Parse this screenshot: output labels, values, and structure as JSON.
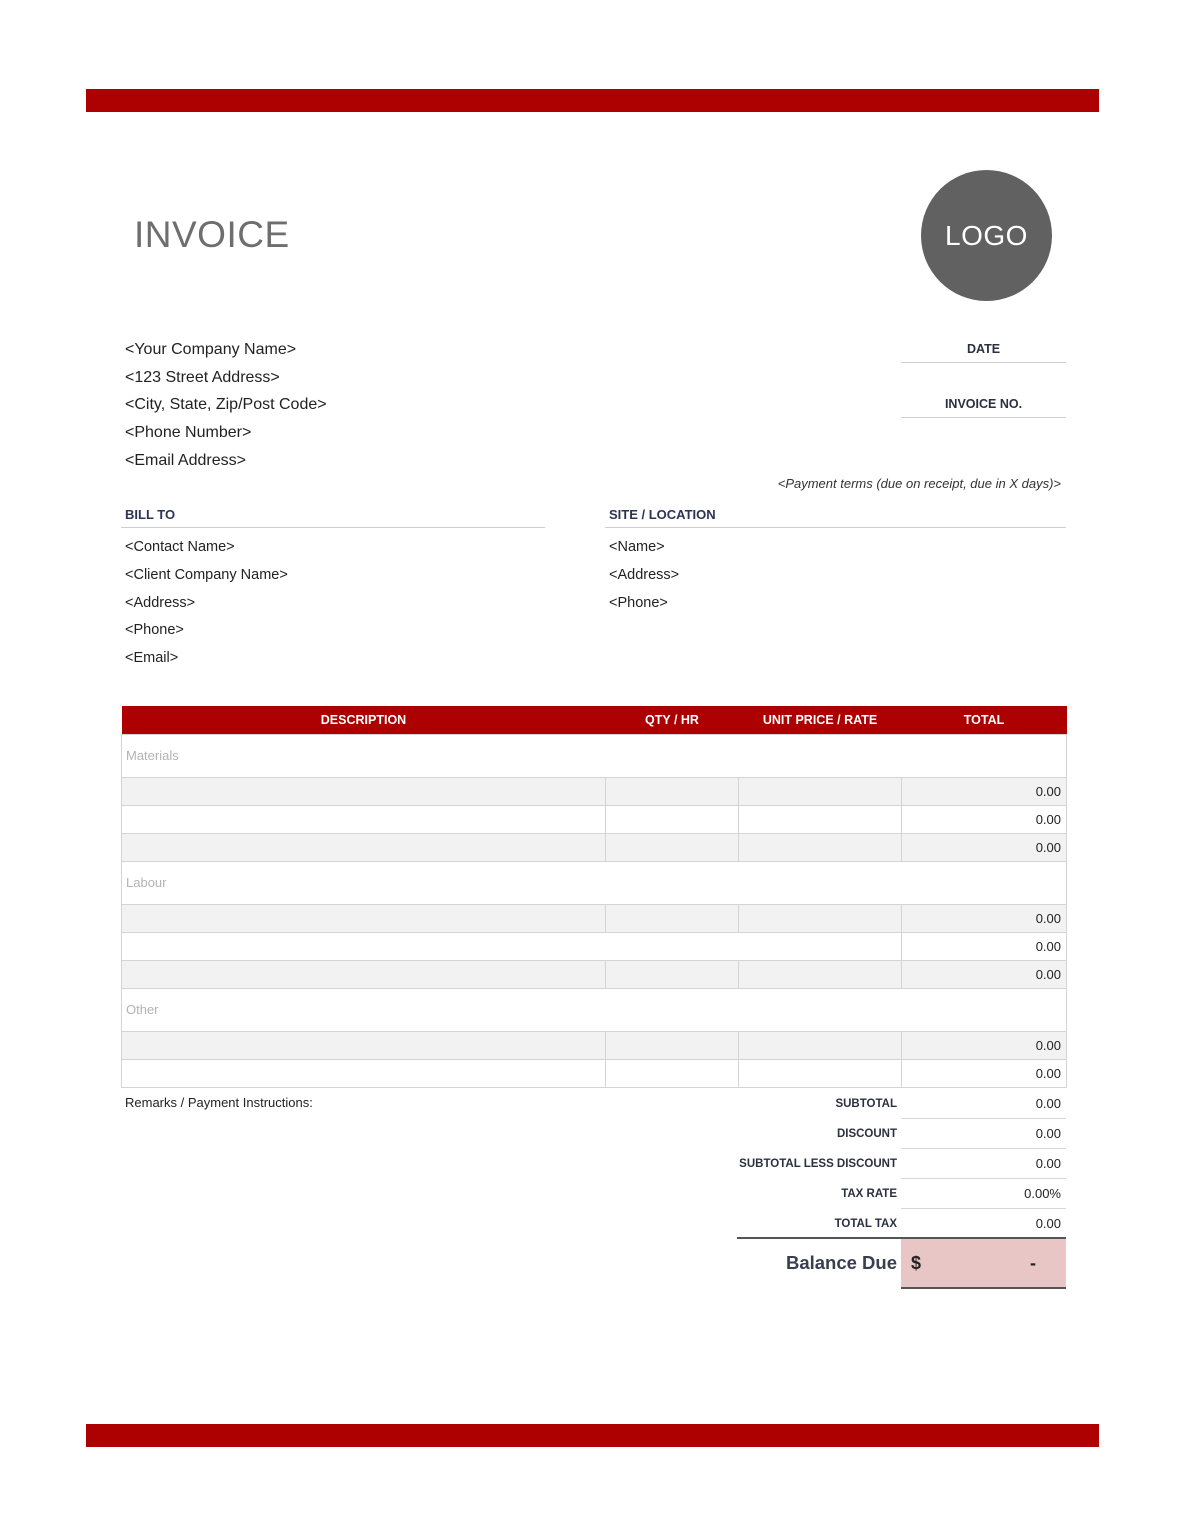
{
  "document": {
    "title": "INVOICE",
    "logo_text": "LOGO",
    "accent_color": "#ad0000"
  },
  "company": {
    "lines": [
      "<Your Company Name>",
      "<123 Street Address>",
      "<City, State, Zip/Post Code>",
      "<Phone Number>",
      "<Email Address>"
    ]
  },
  "meta": {
    "date_label": "DATE",
    "invoice_no_label": "INVOICE NO.",
    "payment_terms": "<Payment terms (due on receipt, due in X days)>"
  },
  "bill_to": {
    "heading": "BILL TO",
    "lines": [
      "<Contact Name>",
      "<Client Company Name>",
      "<Address>",
      "<Phone>",
      "<Email>"
    ]
  },
  "site": {
    "heading": "SITE / LOCATION",
    "lines": [
      "<Name>",
      "<Address>",
      "<Phone>"
    ]
  },
  "table": {
    "headers": [
      "DESCRIPTION",
      "QTY / HR",
      "UNIT PRICE / RATE",
      "TOTAL"
    ],
    "sections": [
      {
        "name": "Materials",
        "rows": [
          {
            "description": "",
            "qty": "",
            "rate": "",
            "total": "0.00"
          },
          {
            "description": "",
            "qty": "",
            "rate": "",
            "total": "0.00"
          },
          {
            "description": "",
            "qty": "",
            "rate": "",
            "total": "0.00"
          }
        ]
      },
      {
        "name": "Labour",
        "rows": [
          {
            "description": "",
            "qty": "",
            "rate": "",
            "total": "0.00"
          },
          {
            "description": "",
            "qty": "",
            "rate": "",
            "total": "0.00"
          },
          {
            "description": "",
            "qty": "",
            "rate": "",
            "total": "0.00"
          }
        ]
      },
      {
        "name": "Other",
        "rows": [
          {
            "description": "",
            "qty": "",
            "rate": "",
            "total": "0.00"
          },
          {
            "description": "",
            "qty": "",
            "rate": "",
            "total": "0.00"
          }
        ]
      }
    ]
  },
  "remarks_label": "Remarks / Payment Instructions:",
  "totals": [
    {
      "label": "SUBTOTAL",
      "value": "0.00"
    },
    {
      "label": "DISCOUNT",
      "value": "0.00"
    },
    {
      "label": "SUBTOTAL LESS DISCOUNT",
      "value": "0.00"
    },
    {
      "label": "TAX RATE",
      "value": "0.00%"
    },
    {
      "label": "TOTAL TAX",
      "value": "0.00"
    }
  ],
  "balance_due": {
    "label": "Balance Due",
    "currency": "$",
    "value": "-"
  }
}
